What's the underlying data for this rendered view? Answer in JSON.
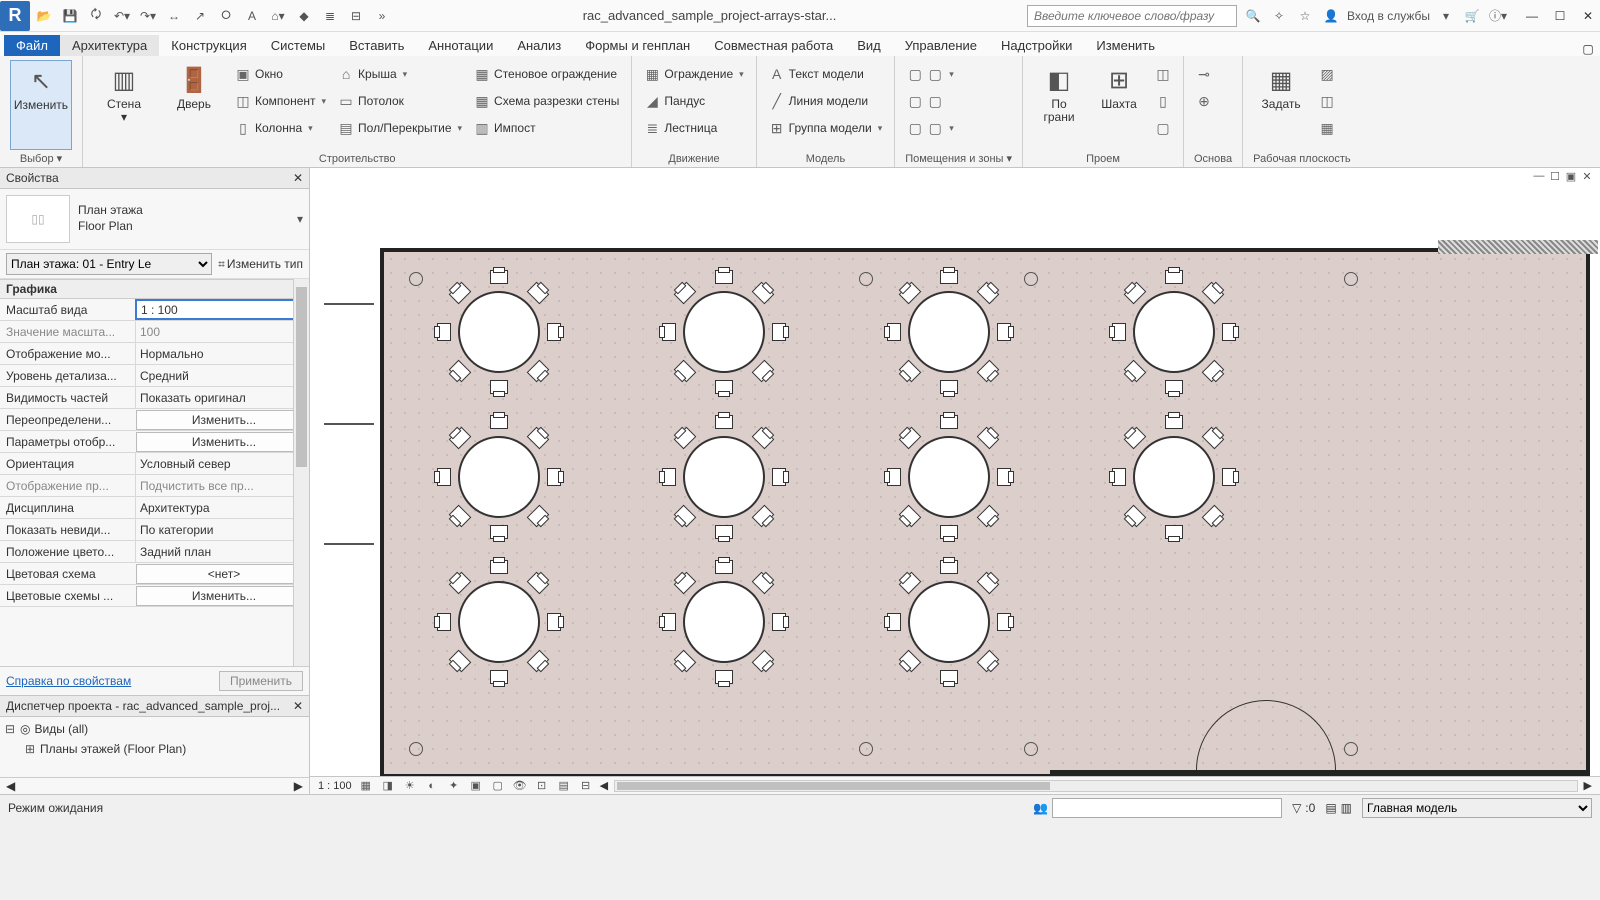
{
  "titlebar": {
    "project": "rac_advanced_sample_project-arrays-star...",
    "search_placeholder": "Введите ключевое слово/фразу",
    "signin": "Вход в службы"
  },
  "tabs": {
    "file": "Файл",
    "architecture": "Архитектура",
    "structure": "Конструкция",
    "systems": "Системы",
    "insert": "Вставить",
    "annotate": "Аннотации",
    "analyze": "Анализ",
    "massing": "Формы и генплан",
    "collaborate": "Совместная работа",
    "view": "Вид",
    "manage": "Управление",
    "addins": "Надстройки",
    "modify": "Изменить"
  },
  "ribbon": {
    "select": {
      "modify": "Изменить",
      "title": "Выбор"
    },
    "build": {
      "wall": "Стена",
      "door": "Дверь",
      "window": "Окно",
      "component": "Компонент",
      "column": "Колонна",
      "roof": "Крыша",
      "ceiling": "Потолок",
      "floor": "Пол/Перекрытие",
      "curtain_wall": "Стеновое ограждение",
      "curtain_grid": "Схема разрезки стены",
      "mullion": "Импост",
      "title": "Строительство"
    },
    "circ": {
      "railing": "Ограждение",
      "ramp": "Пандус",
      "stair": "Лестница",
      "title": "Движение"
    },
    "model": {
      "text": "Текст модели",
      "line": "Линия модели",
      "group": "Группа модели",
      "title": "Модель"
    },
    "rooms": {
      "title": "Помещения и зоны"
    },
    "opening": {
      "byface": "По грани",
      "shaft": "Шахта",
      "title": "Проем"
    },
    "datum": {
      "title": "Основа"
    },
    "workplane": {
      "set": "Задать",
      "title": "Рабочая плоскость"
    }
  },
  "props": {
    "title": "Свойства",
    "type_line1": "План этажа",
    "type_line2": "Floor Plan",
    "instance": "План этажа: 01 - Entry Le",
    "edit_type": "Изменить тип",
    "group": "Графика",
    "rows": {
      "view_scale_k": "Масштаб вида",
      "view_scale_v": "1 : 100",
      "scale_value_k": "Значение масшта...",
      "scale_value_v": "100",
      "display_model_k": "Отображение мо...",
      "display_model_v": "Нормально",
      "detail_k": "Уровень детализа...",
      "detail_v": "Средний",
      "parts_k": "Видимость частей",
      "parts_v": "Показать оригинал",
      "vg_k": "Переопределени...",
      "vg_v": "Изменить...",
      "gfx_k": "Параметры отобр...",
      "gfx_v": "Изменить...",
      "orient_k": "Ориентация",
      "orient_v": "Условный север",
      "wall_k": "Отображение пр...",
      "wall_v": "Подчистить все пр...",
      "disc_k": "Дисциплина",
      "disc_v": "Архитектура",
      "hidden_k": "Показать невиди...",
      "hidden_v": "По категории",
      "color_loc_k": "Положение цвето...",
      "color_loc_v": "Задний план",
      "color_k": "Цветовая схема",
      "color_v": "<нет>",
      "color_sch_k": "Цветовые схемы ...",
      "color_sch_v": "Изменить..."
    },
    "help": "Справка по свойствам",
    "apply": "Применить"
  },
  "browser": {
    "title": "Диспетчер проекта - rac_advanced_sample_proj...",
    "views": "Виды (all)",
    "floor_plans": "Планы этажей (Floor Plan)"
  },
  "viewbar": {
    "scale": "1 : 100"
  },
  "status": {
    "mode": "Режим ожидания",
    "zero": ":0",
    "workset": "Главная модель"
  }
}
